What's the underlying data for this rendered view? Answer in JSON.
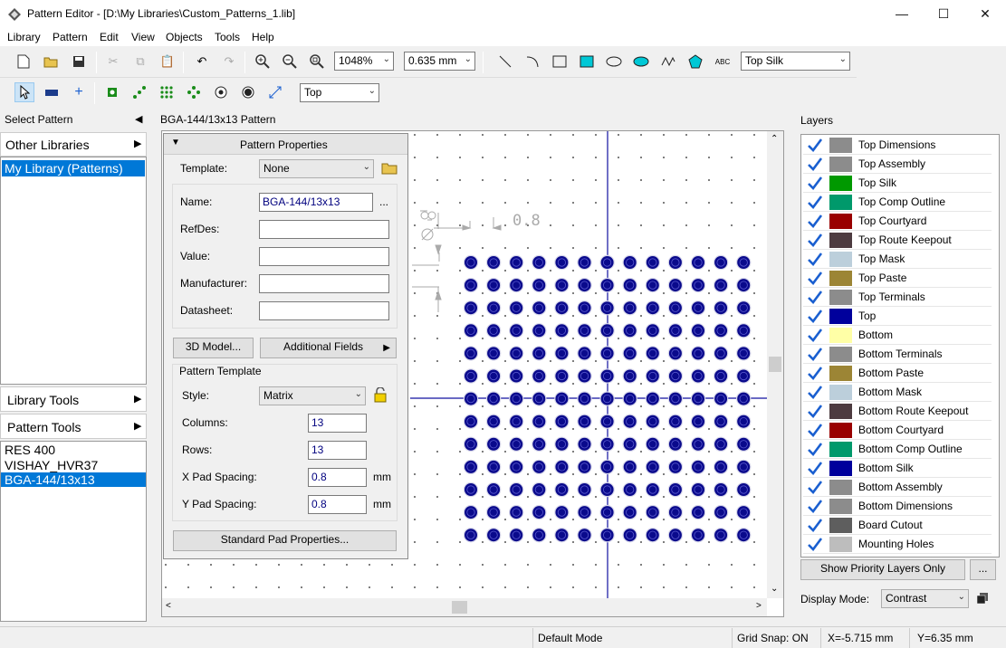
{
  "window": {
    "title": "Pattern Editor - [D:\\My Libraries\\Custom_Patterns_1.lib]",
    "minimize": "—",
    "maximize": "☐",
    "close": "✕"
  },
  "menu": [
    "Library",
    "Pattern",
    "Edit",
    "View",
    "Objects",
    "Tools",
    "Help"
  ],
  "toolbar": {
    "zoom": "1048%",
    "grid": "0.635 mm",
    "layer_select": "Top Silk",
    "side_select": "Top",
    "text_tool": "ABC"
  },
  "left": {
    "select_pattern": "Select Pattern",
    "other_libraries": "Other Libraries",
    "my_library": "My Library (Patterns)",
    "library_tools": "Library Tools",
    "pattern_tools": "Pattern Tools",
    "patterns": [
      "RES 400",
      "VISHAY_HVR37",
      "BGA-144/13x13"
    ]
  },
  "center": {
    "header": "BGA-144/13x13 Pattern",
    "dim_label": "0.8",
    "grid": {
      "columns": 13,
      "rows": 13
    }
  },
  "props": {
    "title": "Pattern Properties",
    "template_label": "Template:",
    "template_value": "None",
    "name_label": "Name:",
    "name_value": "BGA-144/13x13",
    "ellipsis": "...",
    "refdes_label": "RefDes:",
    "value_label": "Value:",
    "manufacturer_label": "Manufacturer:",
    "datasheet_label": "Datasheet:",
    "model_btn": "3D Model...",
    "fields_btn": "Additional Fields",
    "pattern_template": "Pattern Template",
    "style_label": "Style:",
    "style_value": "Matrix",
    "columns_label": "Columns:",
    "columns_value": "13",
    "rows_label": "Rows:",
    "rows_value": "13",
    "xpad_label": "X Pad Spacing:",
    "xpad_value": "0.8",
    "ypad_label": "Y Pad Spacing:",
    "ypad_value": "0.8",
    "unit": "mm",
    "std_pad_btn": "Standard Pad Properties..."
  },
  "layers": {
    "title": "Layers",
    "items": [
      {
        "name": "Top Dimensions",
        "color": "#8c8c8c"
      },
      {
        "name": "Top Assembly",
        "color": "#8c8c8c"
      },
      {
        "name": "Top Silk",
        "color": "#009900"
      },
      {
        "name": "Top Comp Outline",
        "color": "#00996b"
      },
      {
        "name": "Top Courtyard",
        "color": "#990000"
      },
      {
        "name": "Top Route Keepout",
        "color": "#4d3b40"
      },
      {
        "name": "Top Mask",
        "color": "#bccfdb"
      },
      {
        "name": "Top Paste",
        "color": "#9c8535"
      },
      {
        "name": "Top Terminals",
        "color": "#8c8c8c"
      },
      {
        "name": "Top",
        "color": "#00009c"
      },
      {
        "name": "Bottom",
        "color": "#ffffa6"
      },
      {
        "name": "Bottom Terminals",
        "color": "#8c8c8c"
      },
      {
        "name": "Bottom Paste",
        "color": "#9c8535"
      },
      {
        "name": "Bottom Mask",
        "color": "#bccfdb"
      },
      {
        "name": "Bottom Route Keepout",
        "color": "#4d3b40"
      },
      {
        "name": "Bottom Courtyard",
        "color": "#990000"
      },
      {
        "name": "Bottom Comp Outline",
        "color": "#00996b"
      },
      {
        "name": "Bottom Silk",
        "color": "#00009c"
      },
      {
        "name": "Bottom Assembly",
        "color": "#8c8c8c"
      },
      {
        "name": "Bottom Dimensions",
        "color": "#8c8c8c"
      },
      {
        "name": "Board Cutout",
        "color": "#5e5e5e"
      },
      {
        "name": "Mounting Holes",
        "color": "#bdbdbd"
      }
    ],
    "priority_btn": "Show Priority Layers Only",
    "more_btn": "...",
    "display_mode_label": "Display Mode:",
    "display_mode_value": "Contrast"
  },
  "status": {
    "mode": "Default Mode",
    "snap": "Grid Snap: ON",
    "x": "X=-5.715 mm",
    "y": "Y=6.35 mm"
  }
}
